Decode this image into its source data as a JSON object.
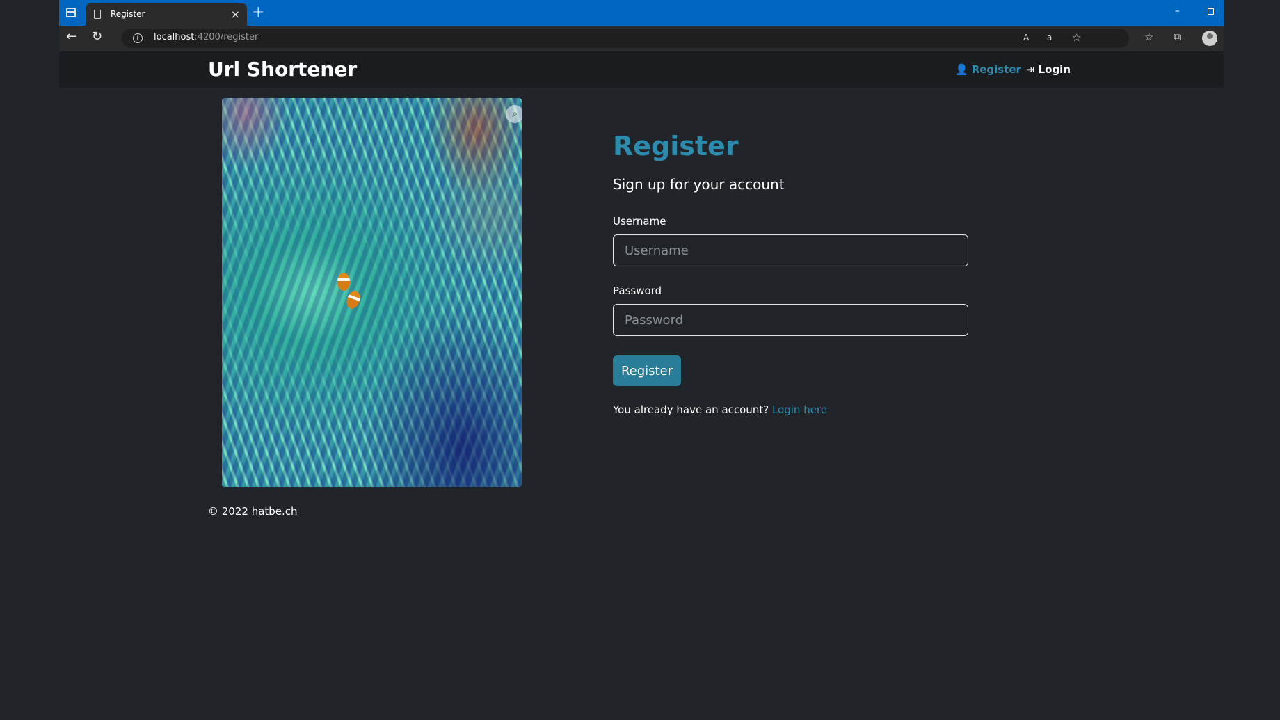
{
  "browser": {
    "tab_title": "Register",
    "tab_close": "×",
    "new_tab": "+",
    "url_host": "localhost",
    "url_path": ":4200/register",
    "window_minimize": "–",
    "icons": [
      "tab-actions-icon",
      "page-icon",
      "back-icon",
      "refresh-icon",
      "info-icon",
      "read-aloud-icon",
      "translate-icon",
      "add-favorite-icon",
      "favorites-icon",
      "collections-icon",
      "profile-icon"
    ]
  },
  "navbar": {
    "brand": "Url Shortener",
    "register": "Register",
    "login": "Login"
  },
  "main": {
    "heading": "Register",
    "subtitle": "Sign up for your account",
    "username_label": "Username",
    "username_placeholder": "Username",
    "password_label": "Password",
    "password_placeholder": "Password",
    "submit": "Register",
    "account_prompt": "You already have an account?",
    "login_link": "Login here"
  },
  "footer": {
    "text": "© 2022 hatbe.ch"
  },
  "colors": {
    "accent": "#2d8cad",
    "button": "#2a7d99",
    "background": "#212529",
    "navbar": "#1a1d20",
    "titlebar": "#0067c0"
  }
}
